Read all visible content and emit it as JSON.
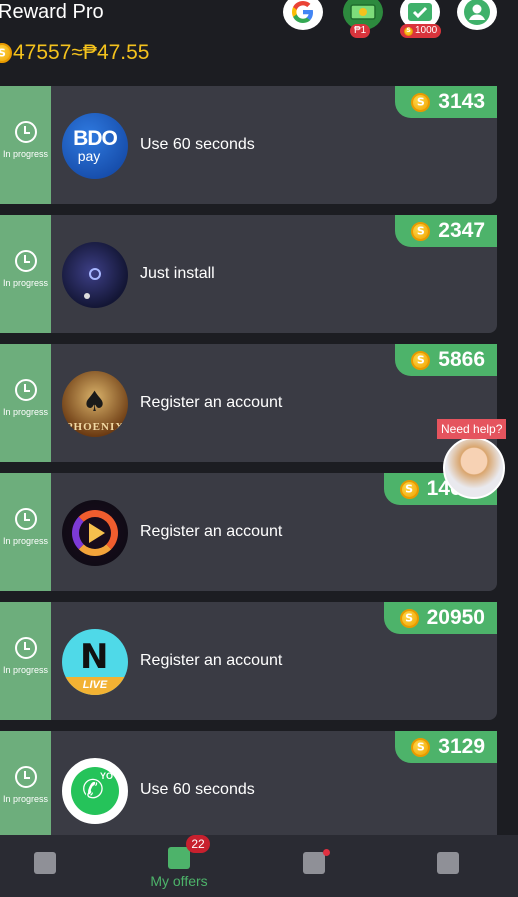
{
  "header": {
    "title": "Reward Pro",
    "balance_coins": "47557",
    "balance_approx": "≈₱47.55",
    "icons": [
      "google-icon",
      "cash-icon",
      "task-icon",
      "user-icon"
    ],
    "badge_cash": "₱1",
    "badge_task": "1000"
  },
  "offers": [
    {
      "status": "In progress",
      "reward": "3143",
      "task": "Use 60 seconds",
      "icon": "bdo-pay-app-icon"
    },
    {
      "status": "In progress",
      "reward": "2347",
      "task": "Just install",
      "icon": "space-app-icon"
    },
    {
      "status": "In progress",
      "reward": "5866",
      "task": "Register an account",
      "icon": "phoenix-app-icon"
    },
    {
      "status": "In progress",
      "reward": "14600",
      "task": "Register an account",
      "icon": "stream-app-icon"
    },
    {
      "status": "In progress",
      "reward": "20950",
      "task": "Register an account",
      "icon": "live-app-icon"
    },
    {
      "status": "In progress",
      "reward": "3129",
      "task": "Use 60 seconds",
      "icon": "whatsapp-app-icon"
    }
  ],
  "app_icon_text": {
    "bdo_line1": "BDO",
    "bdo_line2": "pay",
    "phoenix": "PHOENIX",
    "live": "LIVE",
    "yo": "YO"
  },
  "helper": {
    "label": "Need help?"
  },
  "nav": {
    "items": [
      "wallet-icon",
      "my-offers-icon",
      "mail-icon",
      "card-icon"
    ],
    "active_label": "My offers",
    "offers_badge": "22"
  },
  "colors": {
    "accent": "#4db36a",
    "status": "#6dae7c",
    "coin": "#f4c21d",
    "card": "#3a3b44",
    "background": "#1c1d22"
  }
}
